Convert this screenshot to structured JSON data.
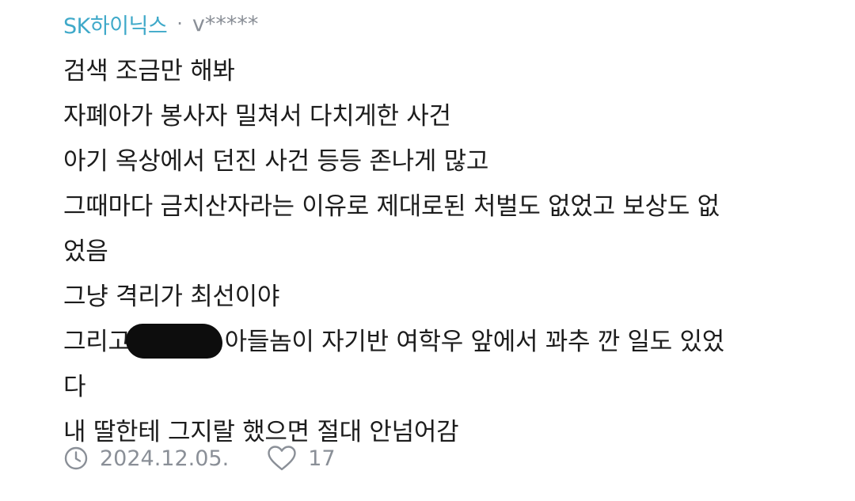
{
  "comment": {
    "company": "SK하이닉스",
    "separator": "·",
    "author": "v*****",
    "lines": {
      "l0": "검색 조금만 해봐",
      "l1": "자폐아가 봉사자 밀쳐서 다치게한 사건",
      "l2": "아기 옥상에서 던진 사건 등등 존나게 많고",
      "l3": "그때마다 금치산자라는 이유로 제대로된 처벌도 없었고 보상도 없",
      "l4": "었음",
      "l5": "그냥 격리가 최선이야",
      "l6a": "그리고",
      "l6b": "아들놈이 자기반 여학우 앞에서 꽈추 깐 일도 있었",
      "l7": "다",
      "l8": "내 딸한테 그지랄 했으면 절대 안넘어감"
    },
    "date": "2024.12.05.",
    "likes": "17",
    "icons": {
      "clock": "clock-icon",
      "heart": "heart-icon"
    },
    "colors": {
      "company": "#3fa9c9",
      "meta": "#8a8f97",
      "text": "#1c1c1c",
      "redaction": "#0d0d0d"
    }
  }
}
